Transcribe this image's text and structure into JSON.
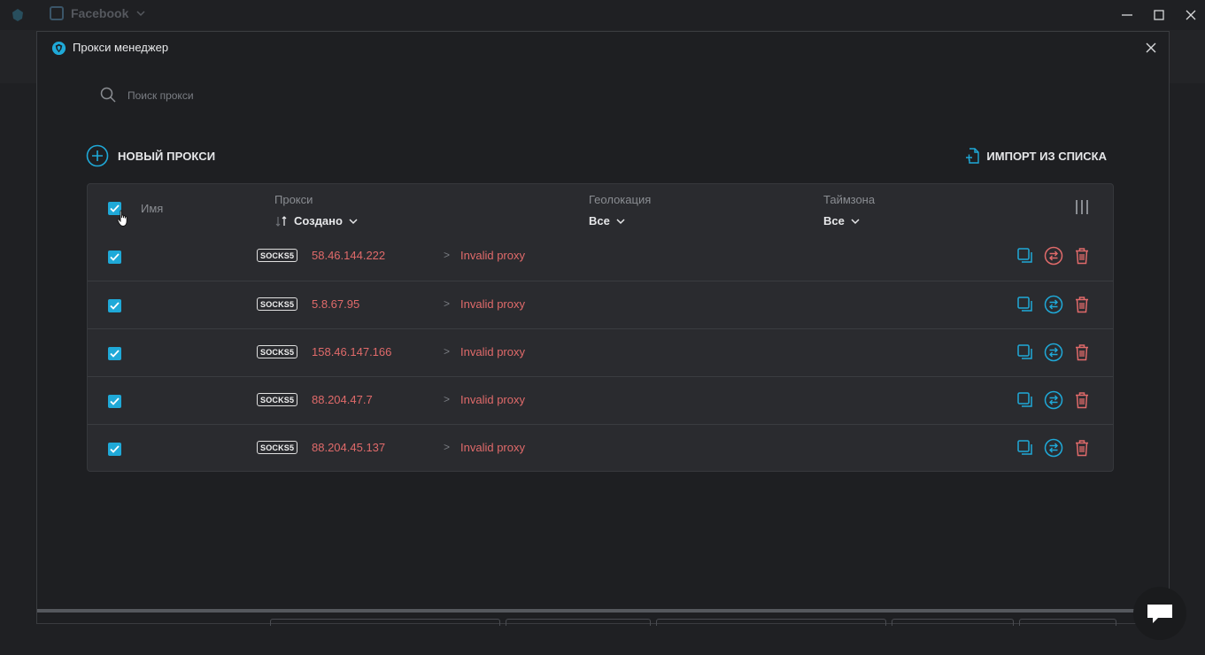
{
  "background_app": {
    "tab_title": "Facebook"
  },
  "modal": {
    "title": "Прокси менеджер"
  },
  "search": {
    "placeholder": "Поиск прокси"
  },
  "toolbar": {
    "new_proxy_label": "НОВЫЙ ПРОКСИ",
    "import_label": "ИМПОРТ ИЗ СПИСКА"
  },
  "table": {
    "columns": {
      "name": "Имя",
      "proxy": "Прокси",
      "sort": "Создано",
      "geo": "Геолокация",
      "geo_filter": "Все",
      "timezone": "Таймзона",
      "timezone_filter": "Все"
    },
    "rows": [
      {
        "type": "SOCKS5",
        "ip": "58.46.144.222",
        "status": "Invalid proxy",
        "checked": true
      },
      {
        "type": "SOCKS5",
        "ip": "5.8.67.95",
        "status": "Invalid proxy",
        "checked": true
      },
      {
        "type": "SOCKS5",
        "ip": "158.46.147.166",
        "status": "Invalid proxy",
        "checked": true
      },
      {
        "type": "SOCKS5",
        "ip": "88.204.47.7",
        "status": "Invalid proxy",
        "checked": true
      },
      {
        "type": "SOCKS5",
        "ip": "88.204.45.137",
        "status": "Invalid proxy",
        "checked": true
      }
    ],
    "row_arrow": ">"
  },
  "colors": {
    "accent": "#1fa9d8",
    "error": "#e06a6a",
    "background": "#1e1f22",
    "table_bg": "#2a2b2f"
  }
}
